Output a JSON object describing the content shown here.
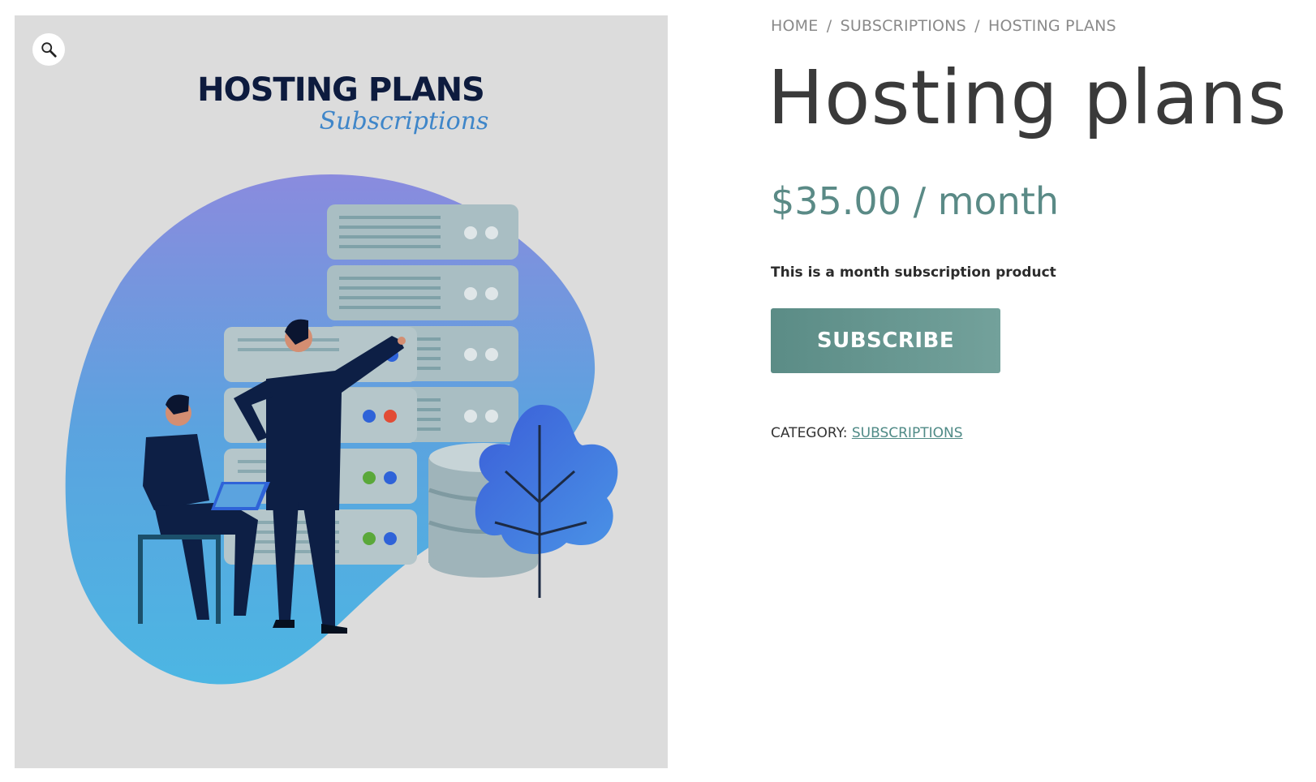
{
  "gallery": {
    "image_heading": "HOSTING PLANS",
    "image_subheading": "Subscriptions",
    "zoom_icon": "magnifier-icon"
  },
  "breadcrumb": {
    "items": [
      "HOME",
      "SUBSCRIPTIONS",
      "HOSTING PLANS"
    ],
    "separator": "/"
  },
  "product": {
    "title": "Hosting plans",
    "price": "$35.00",
    "price_period": "/ month",
    "description": "This is a month subscription product",
    "subscribe_label": "SUBSCRIBE",
    "category_label": "CATEGORY:",
    "category_value": "SUBSCRIPTIONS"
  },
  "colors": {
    "accent": "#5b8c86",
    "title": "#3a3a3a",
    "breadcrumb": "#8a8a8a",
    "image_background": "#dcdcdc"
  }
}
